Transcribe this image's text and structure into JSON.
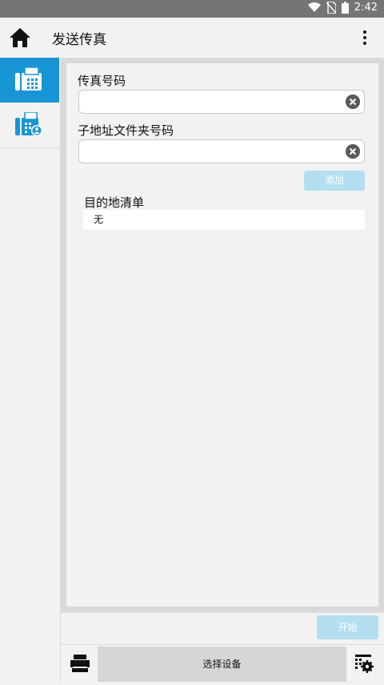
{
  "status_bar": {
    "time": "2:42",
    "icons": [
      "wifi-icon",
      "no-sim-icon",
      "battery-icon"
    ]
  },
  "app_bar": {
    "title": "发送传真",
    "home_icon": "home-icon",
    "menu_icon": "more-vertical-icon"
  },
  "sidebar": {
    "items": [
      {
        "name": "fax-send",
        "icon": "fax-icon",
        "active": true
      },
      {
        "name": "fax-address-book",
        "icon": "fax-contact-icon",
        "active": false
      }
    ]
  },
  "form": {
    "fax_number_label": "传真号码",
    "fax_number_value": "",
    "subaddress_label": "子地址文件夹号码",
    "subaddress_value": "",
    "add_button": "添加"
  },
  "destination_list": {
    "title": "目的地清单",
    "items": [
      "无"
    ]
  },
  "footer": {
    "start_button": "开始",
    "select_device_button": "选择设备"
  },
  "colors": {
    "accent": "#1795d4",
    "disabled_button": "#b3dff1",
    "status_bar": "#757575"
  }
}
